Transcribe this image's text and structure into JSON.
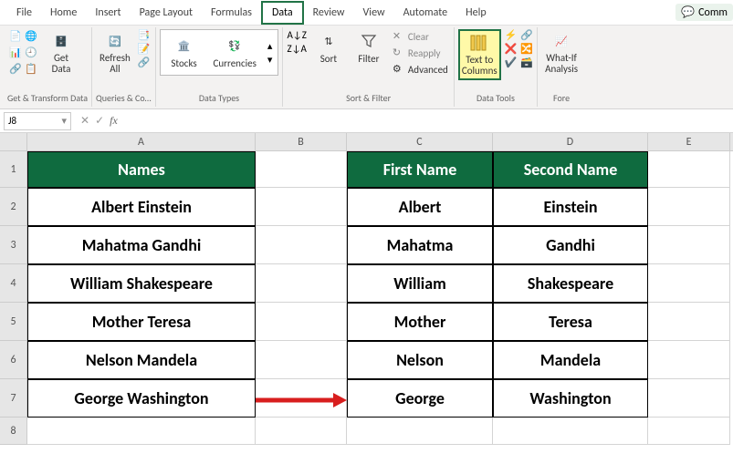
{
  "menubar": {
    "items": [
      "File",
      "Home",
      "Insert",
      "Page Layout",
      "Formulas",
      "Data",
      "Review",
      "View",
      "Automate",
      "Help"
    ],
    "active_index": 5,
    "comments_label": "Comm"
  },
  "ribbon": {
    "groups": [
      {
        "label": "Get & Transform Data",
        "get_data": "Get\nData"
      },
      {
        "label": "Queries & Co…",
        "refresh": "Refresh\nAll"
      },
      {
        "label": "Data Types",
        "stocks": "Stocks",
        "currencies": "Currencies"
      },
      {
        "label": "Sort & Filter",
        "sort": "Sort",
        "filter": "Filter",
        "clear": "Clear",
        "reapply": "Reapply",
        "advanced": "Advanced"
      },
      {
        "label": "Data Tools",
        "text_to_columns": "Text to\nColumns"
      },
      {
        "label": "Fore",
        "whatif": "What-If\nAnalysis"
      }
    ]
  },
  "formula_bar": {
    "cell_ref": "J8",
    "formula": ""
  },
  "grid": {
    "columns": [
      "A",
      "B",
      "C",
      "D",
      "E"
    ],
    "rows": [
      "1",
      "2",
      "3",
      "4",
      "5",
      "6",
      "7",
      "8"
    ],
    "headers": {
      "A": "Names",
      "C": "First Name",
      "D": "Second Name"
    },
    "data": [
      {
        "full": "Albert Einstein",
        "first": "Albert",
        "second": "Einstein"
      },
      {
        "full": "Mahatma Gandhi",
        "first": "Mahatma",
        "second": "Gandhi"
      },
      {
        "full": "William Shakespeare",
        "first": "William",
        "second": "Shakespeare"
      },
      {
        "full": "Mother Teresa",
        "first": "Mother",
        "second": "Teresa"
      },
      {
        "full": "Nelson Mandela",
        "first": "Nelson",
        "second": "Mandela"
      },
      {
        "full": "George Washington",
        "first": "George",
        "second": "Washington"
      }
    ]
  }
}
